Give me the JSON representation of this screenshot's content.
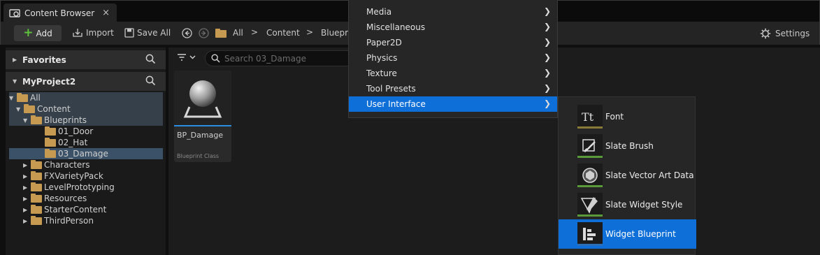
{
  "tab": {
    "title": "Content Browser",
    "close": "×"
  },
  "toolbar": {
    "add_label": "Add",
    "import_label": "Import",
    "save_all_label": "Save All",
    "breadcrumbs": [
      "All",
      "Content",
      "Blueprints"
    ],
    "settings_label": "Settings"
  },
  "sidebar": {
    "favorites_label": "Favorites",
    "project_label": "MyProject2",
    "tree": [
      {
        "label": "All",
        "depth": 0,
        "expanded": true
      },
      {
        "label": "Content",
        "depth": 1,
        "expanded": true
      },
      {
        "label": "Blueprints",
        "depth": 2,
        "expanded": true
      },
      {
        "label": "01_Door",
        "depth": 3
      },
      {
        "label": "02_Hat",
        "depth": 3
      },
      {
        "label": "03_Damage",
        "depth": 3,
        "selected": true
      },
      {
        "label": "Characters",
        "depth": 2
      },
      {
        "label": "FXVarietyPack",
        "depth": 2
      },
      {
        "label": "LevelPrototyping",
        "depth": 2
      },
      {
        "label": "Resources",
        "depth": 2
      },
      {
        "label": "StarterContent",
        "depth": 2
      },
      {
        "label": "ThirdPerson",
        "depth": 2
      }
    ]
  },
  "content": {
    "search_placeholder": "Search 03_Damage",
    "asset": {
      "name": "BP_Damage",
      "type": "Blueprint Class"
    }
  },
  "menu": {
    "items": [
      {
        "label": "Media"
      },
      {
        "label": "Miscellaneous"
      },
      {
        "label": "Paper2D"
      },
      {
        "label": "Physics"
      },
      {
        "label": "Texture"
      },
      {
        "label": "Tool Presets"
      },
      {
        "label": "User Interface",
        "active": true
      }
    ]
  },
  "submenu": {
    "items": [
      {
        "label": "Font",
        "icon": "font-icon",
        "color": "#8a7a3a"
      },
      {
        "label": "Slate Brush",
        "icon": "slate-brush-icon",
        "color": "#5a9a3a"
      },
      {
        "label": "Slate Vector Art Data",
        "icon": "vector-art-icon",
        "color": "#5a9a3a"
      },
      {
        "label": "Slate Widget Style",
        "icon": "widget-style-icon",
        "color": "#5a9a3a"
      },
      {
        "label": "Widget Blueprint",
        "icon": "widget-blueprint-icon",
        "color": "#2b6fb8",
        "active": true
      }
    ]
  },
  "colors": {
    "accent": "#0f6fd8",
    "add_plus": "#5ec23c",
    "folder": "#c79a52",
    "selection": "#3b5167"
  }
}
